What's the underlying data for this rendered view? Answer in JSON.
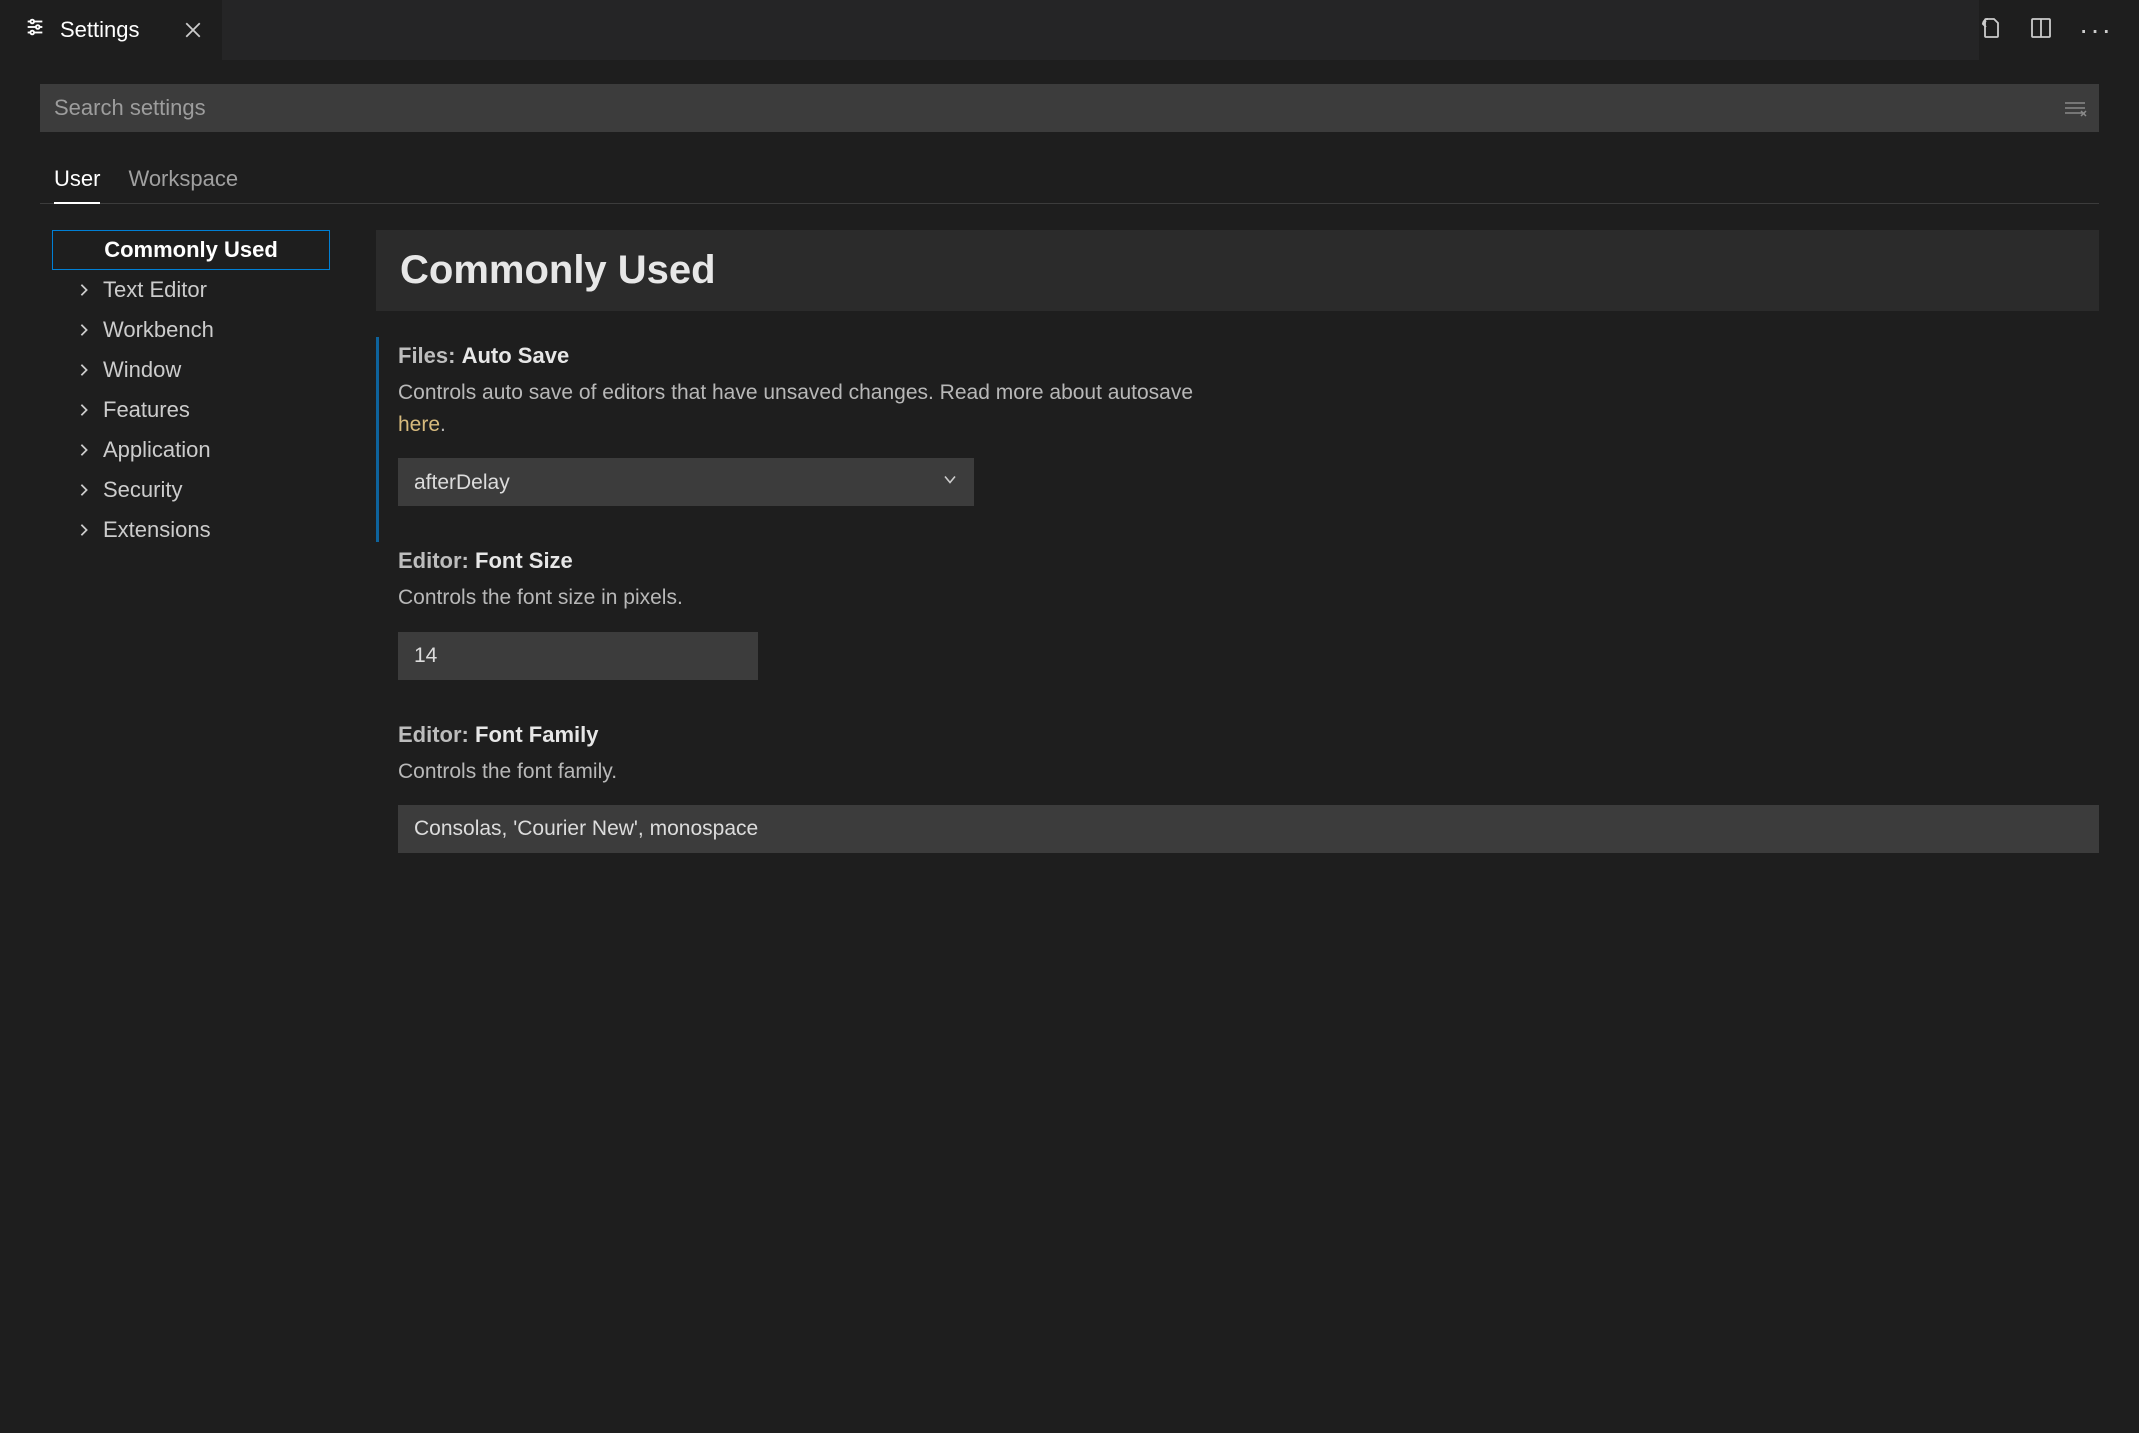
{
  "tab": {
    "title": "Settings"
  },
  "search": {
    "placeholder": "Search settings"
  },
  "scopes": {
    "user": "User",
    "workspace": "Workspace",
    "active": "user"
  },
  "toc": {
    "items": [
      {
        "label": "Commonly Used",
        "selected": true,
        "expandable": false
      },
      {
        "label": "Text Editor",
        "selected": false,
        "expandable": true
      },
      {
        "label": "Workbench",
        "selected": false,
        "expandable": true
      },
      {
        "label": "Window",
        "selected": false,
        "expandable": true
      },
      {
        "label": "Features",
        "selected": false,
        "expandable": true
      },
      {
        "label": "Application",
        "selected": false,
        "expandable": true
      },
      {
        "label": "Security",
        "selected": false,
        "expandable": true
      },
      {
        "label": "Extensions",
        "selected": false,
        "expandable": true
      }
    ]
  },
  "content": {
    "group_title": "Commonly Used",
    "settings": {
      "autoSave": {
        "category": "Files:",
        "name": "Auto Save",
        "description_pre": "Controls auto save of editors that have unsaved changes. Read more about autosave ",
        "link_text": "here",
        "description_post": ".",
        "value": "afterDelay",
        "modified": true
      },
      "fontSize": {
        "category": "Editor:",
        "name": "Font Size",
        "description": "Controls the font size in pixels.",
        "value": "14"
      },
      "fontFamily": {
        "category": "Editor:",
        "name": "Font Family",
        "description": "Controls the font family.",
        "value": "Consolas, 'Courier New', monospace"
      }
    }
  }
}
